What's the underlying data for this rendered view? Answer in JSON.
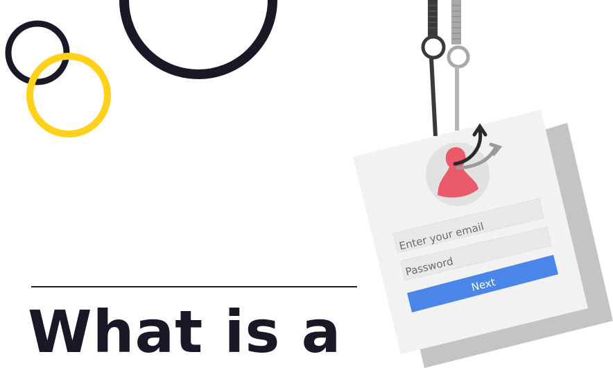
{
  "headline": "What is a",
  "login_card": {
    "email_placeholder": "Enter your email",
    "password_placeholder": "Password",
    "next_label": "Next"
  },
  "colors": {
    "circle_dark": "#181826",
    "circle_yellow": "#ffd11a",
    "card": "#f2f2f2",
    "card_shadow": "#c4c4c4",
    "avatar_bg": "#e2e2e2",
    "avatar": "#ea5a6a",
    "next_button": "#4a86e8"
  },
  "icons": [
    "avatar-icon",
    "fishing-hook-icon",
    "hook-arrow-icon"
  ]
}
